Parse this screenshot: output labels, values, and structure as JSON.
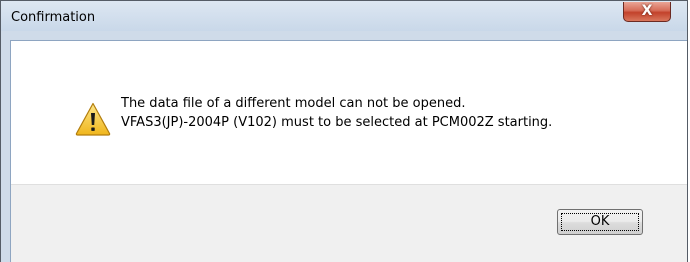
{
  "window": {
    "title": "Confirmation",
    "close_glyph": "X"
  },
  "dialog": {
    "icon": "warning-icon",
    "message_line1": "The data file of a different model can not be opened.",
    "message_line2": "VFAS3(JP)-2004P (V102) must to be selected at PCM002Z starting."
  },
  "buttons": {
    "ok_label": "OK"
  },
  "colors": {
    "title_bar": "#cfdbe9",
    "close_button": "#c7503a",
    "footer": "#f0f0f0",
    "warning_fill": "#f6c531"
  }
}
